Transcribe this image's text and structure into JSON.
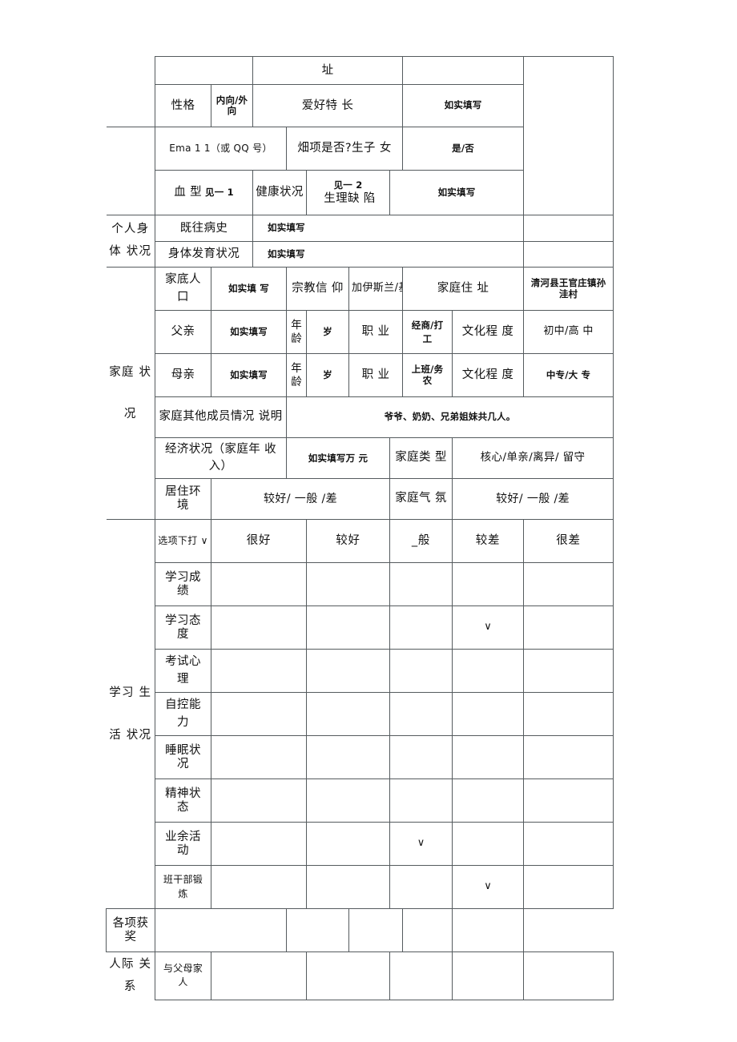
{
  "document": {
    "type": "student-information-form",
    "language": "zh-CN"
  },
  "sections": {
    "personal_body": "个人身 体 状况",
    "family": "家庭 状况",
    "study_life": "学习 生活 状况",
    "interpersonal": "人际 关 系"
  },
  "top_rows": {
    "address_label": "址",
    "personality_label": "性格",
    "personality_value": "内向/外向",
    "hobby_label": "爱好特 长",
    "hobby_value": "如实填写",
    "email_label": "Ema 1 1（或 QQ 号）",
    "only_child_label": "畑项是否?生子 女",
    "only_child_value": "是/否"
  },
  "body_status": {
    "blood_type_label": "血 型",
    "blood_type_value": "见一 1",
    "health_label": "健康状况",
    "health_value": "见一 2",
    "defect_label": "生理缺 陷",
    "defect_value": "如实填写",
    "history_label": "既往病史",
    "history_value": "如实填写",
    "development_label": "身体发育状况",
    "development_value": "如实填写"
  },
  "family": {
    "household_label": "家底人 口",
    "household_value": "如实填 写",
    "religion_label": "宗教信 仰",
    "religion_value": "加伊斯兰/基 於教",
    "home_address_label": "家庭住 址",
    "home_address_value": "清河县王官庄镇孙洼村",
    "father_label": "父亲",
    "father_name_value": "如实填写",
    "father_age_label": "年 龄",
    "father_age_value": "岁",
    "father_job_label": "职 业",
    "father_job_value": "经商/打 工",
    "father_edu_label": "文化程 度",
    "father_edu_value": "初中/高 中",
    "mother_label": "母亲",
    "mother_name_value": "如实填写",
    "mother_age_label": "年 龄",
    "mother_age_value": "岁",
    "mother_job_label": "职 业",
    "mother_job_value": "上班/务 农",
    "mother_edu_label": "文化程 度",
    "mother_edu_value": "中专/大 专",
    "others_label": "家庭其他成员情况 说明",
    "others_value": "爷爷、奶奶、兄弟姐妹共几人。",
    "economy_label": "经济状况（家庭年 收入）",
    "economy_value": "如实填写万 元",
    "family_type_label": "家庭类 型",
    "family_type_value": "核心/单亲/离异/ 留守",
    "living_env_label": "居住环 境",
    "living_env_value": "较好/ 一般 /差",
    "atmosphere_label": "家庭气 氛",
    "atmosphere_value": "较好/ 一般 /差"
  },
  "rating_scale": {
    "instruction_label": "选项下打 ∨",
    "columns": [
      "很好",
      "较好",
      "_般",
      "较差",
      "很差"
    ],
    "tick_glyph": "∨",
    "rows": [
      {
        "label": "学习成 绩",
        "checked": null
      },
      {
        "label": "学习态 度",
        "checked": 3
      },
      {
        "label": "考试心 理",
        "checked": null
      },
      {
        "label": "自控能 力",
        "checked": null
      },
      {
        "label": "睡眠状 况",
        "checked": null
      },
      {
        "label": "精神状 态",
        "checked": null
      },
      {
        "label": "业余活 动",
        "checked": 2
      },
      {
        "label": "班干部锻 炼",
        "checked": 3
      },
      {
        "label": "各项获 奖",
        "checked": null
      },
      {
        "label": "与父母家 人",
        "checked": null
      }
    ]
  }
}
